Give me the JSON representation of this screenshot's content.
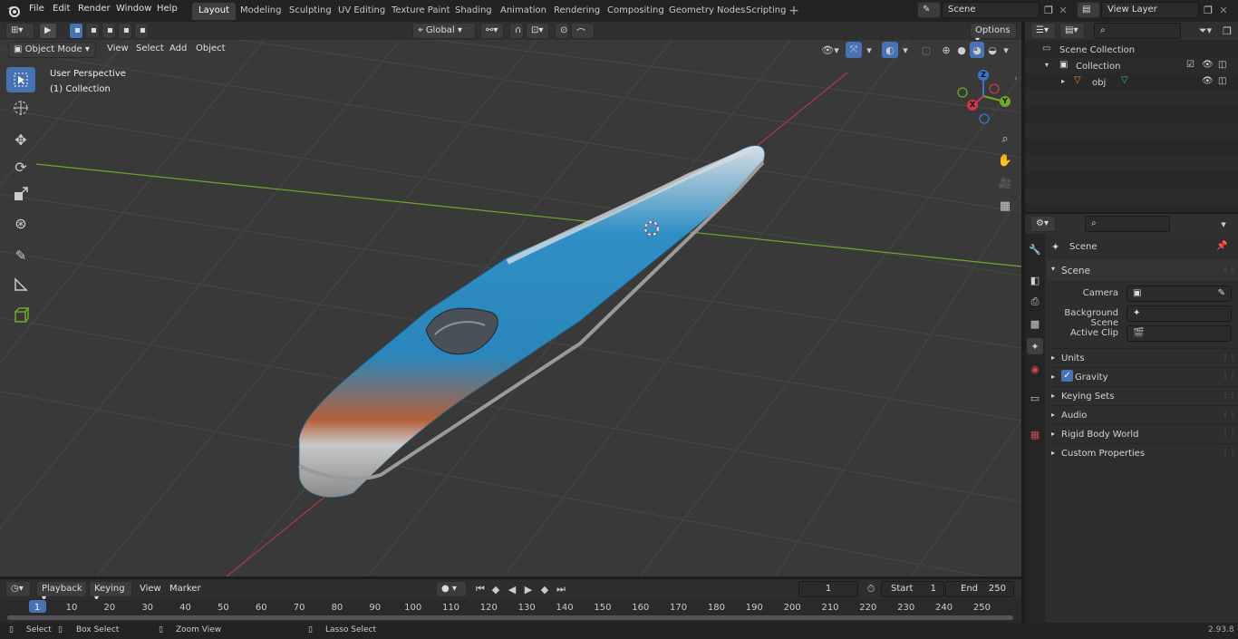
{
  "menus": [
    "File",
    "Edit",
    "Render",
    "Window",
    "Help"
  ],
  "workspaces": [
    "Layout",
    "Modeling",
    "Sculpting",
    "UV Editing",
    "Texture Paint",
    "Shading",
    "Animation",
    "Rendering",
    "Compositing",
    "Geometry Nodes",
    "Scripting"
  ],
  "scene_name": "Scene",
  "view_layer": "View Layer",
  "viewport": {
    "mode": "Object Mode",
    "menus": [
      "View",
      "Select",
      "Add",
      "Object"
    ],
    "transform_orientation": "Global",
    "options_label": "Options",
    "perspective_label": "User Perspective",
    "collection_label": "(1) Collection",
    "axes": {
      "x": "X",
      "y": "Y",
      "z": "Z"
    }
  },
  "outliner": {
    "root": "Scene Collection",
    "collection": "Collection",
    "object": "obj"
  },
  "properties": {
    "context": "Scene",
    "panel": "Scene",
    "camera_label": "Camera",
    "background_scene_label": "Background Scene",
    "active_clip_label": "Active Clip",
    "sections": [
      "Units",
      "Gravity",
      "Keying Sets",
      "Audio",
      "Rigid Body World",
      "Custom Properties"
    ]
  },
  "timeline": {
    "menus": [
      "Playback",
      "Keying",
      "View",
      "Marker"
    ],
    "current_frame": "1",
    "start_label": "Start",
    "start_value": "1",
    "end_label": "End",
    "end_value": "250",
    "ticks": [
      "1",
      "10",
      "20",
      "30",
      "40",
      "50",
      "60",
      "70",
      "80",
      "90",
      "100",
      "110",
      "120",
      "130",
      "140",
      "150",
      "160",
      "170",
      "180",
      "190",
      "200",
      "210",
      "220",
      "230",
      "240",
      "250"
    ]
  },
  "status": {
    "select": "Select",
    "box_select": "Box Select",
    "zoom_view": "Zoom View",
    "lasso_select": "Lasso Select",
    "version": "2.93.8"
  },
  "colors": {
    "accent": "#4772b3",
    "train_blue": "#2f8fc4",
    "x_axis": "#c93a4a",
    "y_axis": "#6fa82a",
    "z_axis": "#3a74d0"
  }
}
